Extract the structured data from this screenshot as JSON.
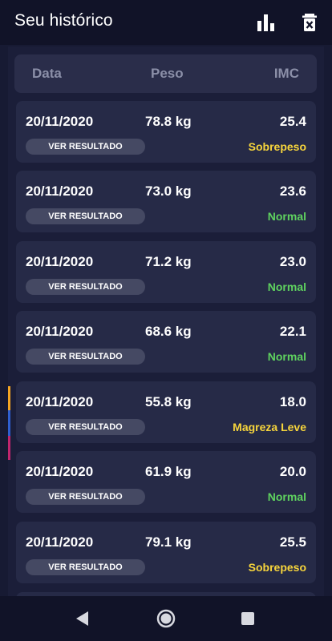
{
  "app_bar": {
    "title": "Seu histórico",
    "chart_icon": "bar-chart-icon",
    "delete_icon": "trash-icon"
  },
  "table_header": {
    "col_date": "Data",
    "col_weight": "Peso",
    "col_bmi": "IMC"
  },
  "rows": [
    {
      "date": "20/11/2020",
      "weight": "78.8 kg",
      "bmi": "25.4",
      "status": "Sobrepeso",
      "button": "VER RESULTADO"
    },
    {
      "date": "20/11/2020",
      "weight": "73.0 kg",
      "bmi": "23.6",
      "status": "Normal",
      "button": "VER RESULTADO"
    },
    {
      "date": "20/11/2020",
      "weight": "71.2 kg",
      "bmi": "23.0",
      "status": "Normal",
      "button": "VER RESULTADO"
    },
    {
      "date": "20/11/2020",
      "weight": "68.6 kg",
      "bmi": "22.1",
      "status": "Normal",
      "button": "VER RESULTADO"
    },
    {
      "date": "20/11/2020",
      "weight": "55.8 kg",
      "bmi": "18.0",
      "status": "Magreza Leve",
      "button": "VER RESULTADO"
    },
    {
      "date": "20/11/2020",
      "weight": "61.9 kg",
      "bmi": "20.0",
      "status": "Normal",
      "button": "VER RESULTADO"
    },
    {
      "date": "20/11/2020",
      "weight": "79.1 kg",
      "bmi": "25.5",
      "status": "Sobrepeso",
      "button": "VER RESULTADO"
    }
  ],
  "status_colors": {
    "Sobrepeso": "#f7d53c",
    "Normal": "#5fd35f",
    "Magreza Leve": "#f7d53c"
  },
  "colors": {
    "background": "#171a33",
    "card": "#262a47",
    "accent_orange": "#f5a623",
    "accent_blue": "#2f5fd0",
    "accent_magenta": "#c0256e"
  },
  "nav": {
    "back_icon": "back-triangle-icon",
    "home_icon": "home-circle-icon",
    "recents_icon": "recents-square-icon"
  }
}
